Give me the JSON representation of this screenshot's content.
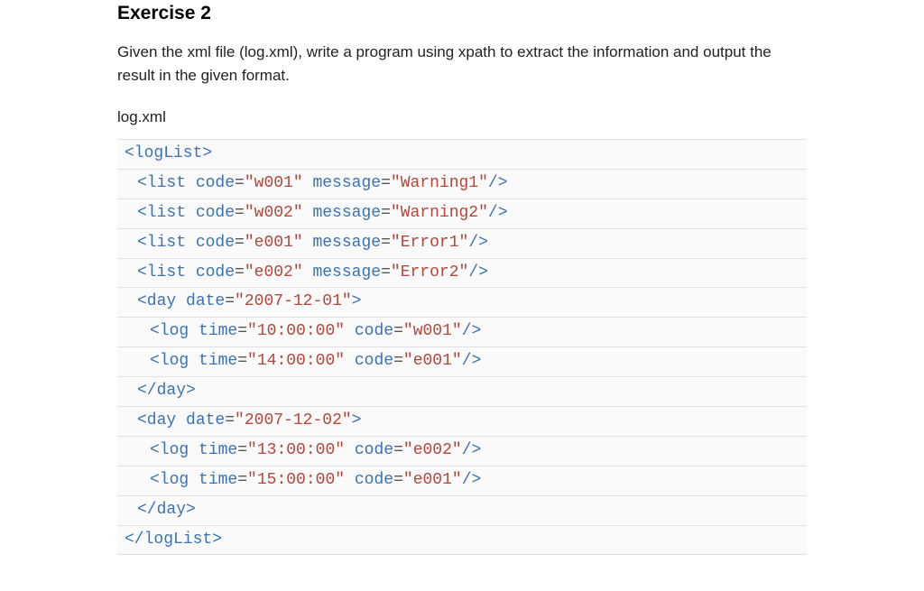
{
  "title": "Exercise 2",
  "description": "Given the xml file (log.xml), write a program using xpath to extract the information and output the result in the given format.",
  "filename": "log.xml",
  "code": {
    "open_logList": "<logList>",
    "list1_a": "<list ",
    "list1_code_attr": "code",
    "list1_eq1": "=",
    "list1_code_val": "\"w001\"",
    "list1_msg_attr": " message",
    "list1_eq2": "=",
    "list1_msg_val": "\"Warning1\"",
    "list1_close": "/>",
    "list2_a": "<list ",
    "list2_code_attr": "code",
    "list2_eq1": "=",
    "list2_code_val": "\"w002\"",
    "list2_msg_attr": " message",
    "list2_eq2": "=",
    "list2_msg_val": "\"Warning2\"",
    "list2_close": "/>",
    "list3_a": "<list ",
    "list3_code_attr": "code",
    "list3_eq1": "=",
    "list3_code_val": "\"e001\"",
    "list3_msg_attr": " message",
    "list3_eq2": "=",
    "list3_msg_val": "\"Error1\"",
    "list3_close": "/>",
    "list4_a": "<list ",
    "list4_code_attr": "code",
    "list4_eq1": "=",
    "list4_code_val": "\"e002\"",
    "list4_msg_attr": " message",
    "list4_eq2": "=",
    "list4_msg_val": "\"Error2\"",
    "list4_close": "/>",
    "day1_open_a": "<day ",
    "day1_date_attr": "date",
    "day1_eq": "=",
    "day1_date_val": "\"2007-12-01\"",
    "day1_open_b": ">",
    "log1_a": "<log ",
    "log1_time_attr": "time",
    "log1_eq1": "=",
    "log1_time_val": "\"10:00:00\"",
    "log1_code_attr": " code",
    "log1_eq2": "=",
    "log1_code_val": "\"w001\"",
    "log1_close": "/>",
    "log2_a": "<log ",
    "log2_time_attr": "time",
    "log2_eq1": "=",
    "log2_time_val": "\"14:00:00\"",
    "log2_code_attr": " code",
    "log2_eq2": "=",
    "log2_code_val": "\"e001\"",
    "log2_close": "/>",
    "day1_close": "</day>",
    "day2_open_a": "<day ",
    "day2_date_attr": "date",
    "day2_eq": "=",
    "day2_date_val": "\"2007-12-02\"",
    "day2_open_b": ">",
    "log3_a": "<log ",
    "log3_time_attr": "time",
    "log3_eq1": "=",
    "log3_time_val": "\"13:00:00\"",
    "log3_code_attr": " code",
    "log3_eq2": "=",
    "log3_code_val": "\"e002\"",
    "log3_close": "/>",
    "log4_a": "<log ",
    "log4_time_attr": "time",
    "log4_eq1": "=",
    "log4_time_val": "\"15:00:00\"",
    "log4_code_attr": " code",
    "log4_eq2": "=",
    "log4_code_val": "\"e001\"",
    "log4_close": "/>",
    "day2_close": "</day>",
    "close_logList": "</logList>"
  }
}
